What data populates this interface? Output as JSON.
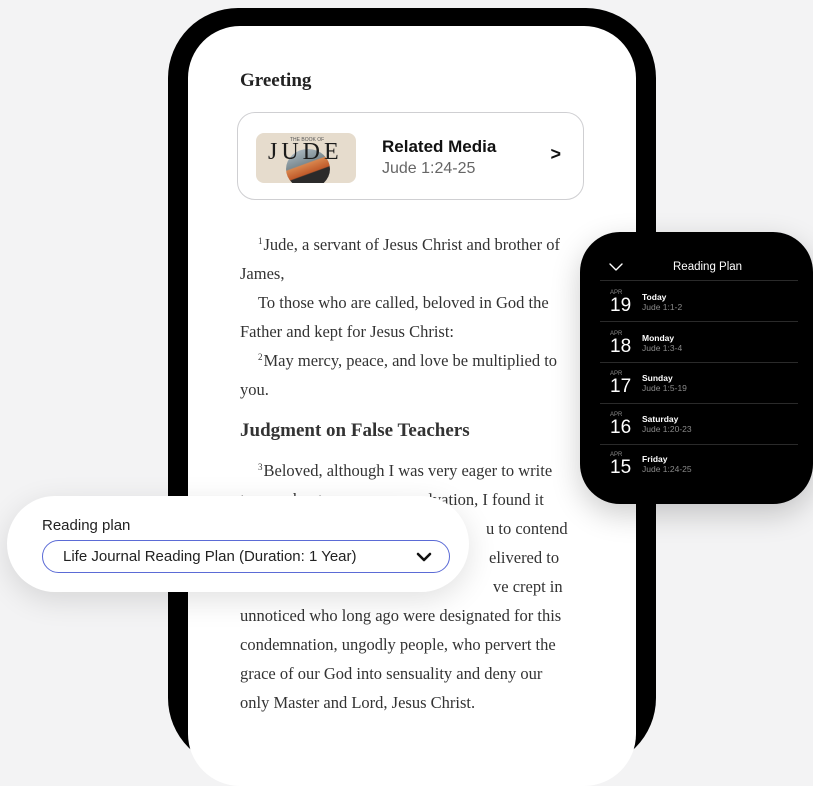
{
  "article": {
    "heading_greeting": "Greeting",
    "related_media": {
      "thumb_word": "JUDE",
      "thumb_pre": "THE BOOK OF",
      "title": "Related Media",
      "reference": "Jude 1:24-25",
      "chevron": ">"
    },
    "verses": [
      {
        "num": "1",
        "text": "Jude, a servant of Jesus Christ and brother of"
      },
      {
        "num": "",
        "text": "James,"
      },
      {
        "num": "",
        "text": "To those who are called, beloved in God the"
      },
      {
        "num": "",
        "text": "Father and kept for Jesus Christ:"
      },
      {
        "num": "2",
        "text": "May mercy, peace, and love be multiplied to"
      },
      {
        "num": "",
        "text": "you."
      }
    ],
    "heading_judgment": "Judgment on False Teachers",
    "verse3": [
      {
        "num": "3",
        "text": "Beloved, although I was very eager to write"
      },
      {
        "num": "",
        "text": "to you about our common salvation, I found it"
      },
      {
        "num": "",
        "text": "u to contend"
      },
      {
        "num": "",
        "text": "elivered to"
      },
      {
        "num": "",
        "text": "ve crept in"
      },
      {
        "num": "",
        "text": "unnoticed who long ago were designated for this"
      },
      {
        "num": "",
        "text": "condemnation, ungodly people, who pervert the"
      },
      {
        "num": "",
        "text": "grace of our God into sensuality and deny our"
      },
      {
        "num": "",
        "text": "only Master and Lord, Jesus Christ."
      }
    ]
  },
  "plan_picker": {
    "label": "Reading plan",
    "selected": "Life Journal Reading Plan (Duration: 1 Year)",
    "chevron_icon": "chevron-down-icon"
  },
  "watch": {
    "title": "Reading Plan",
    "back_icon": "chevron-down-icon",
    "items": [
      {
        "month": "APR",
        "day": "19",
        "name": "Today",
        "ref": "Jude 1:1-2"
      },
      {
        "month": "APR",
        "day": "18",
        "name": "Monday",
        "ref": "Jude 1:3-4"
      },
      {
        "month": "APR",
        "day": "17",
        "name": "Sunday",
        "ref": "Jude 1:5-19"
      },
      {
        "month": "APR",
        "day": "16",
        "name": "Saturday",
        "ref": "Jude 1:20-23"
      },
      {
        "month": "APR",
        "day": "15",
        "name": "Friday",
        "ref": "Jude 1:24-25"
      }
    ]
  },
  "colors": {
    "background": "#f3f3f4",
    "phone_frame": "#000000",
    "select_border": "#5b6bd6"
  }
}
